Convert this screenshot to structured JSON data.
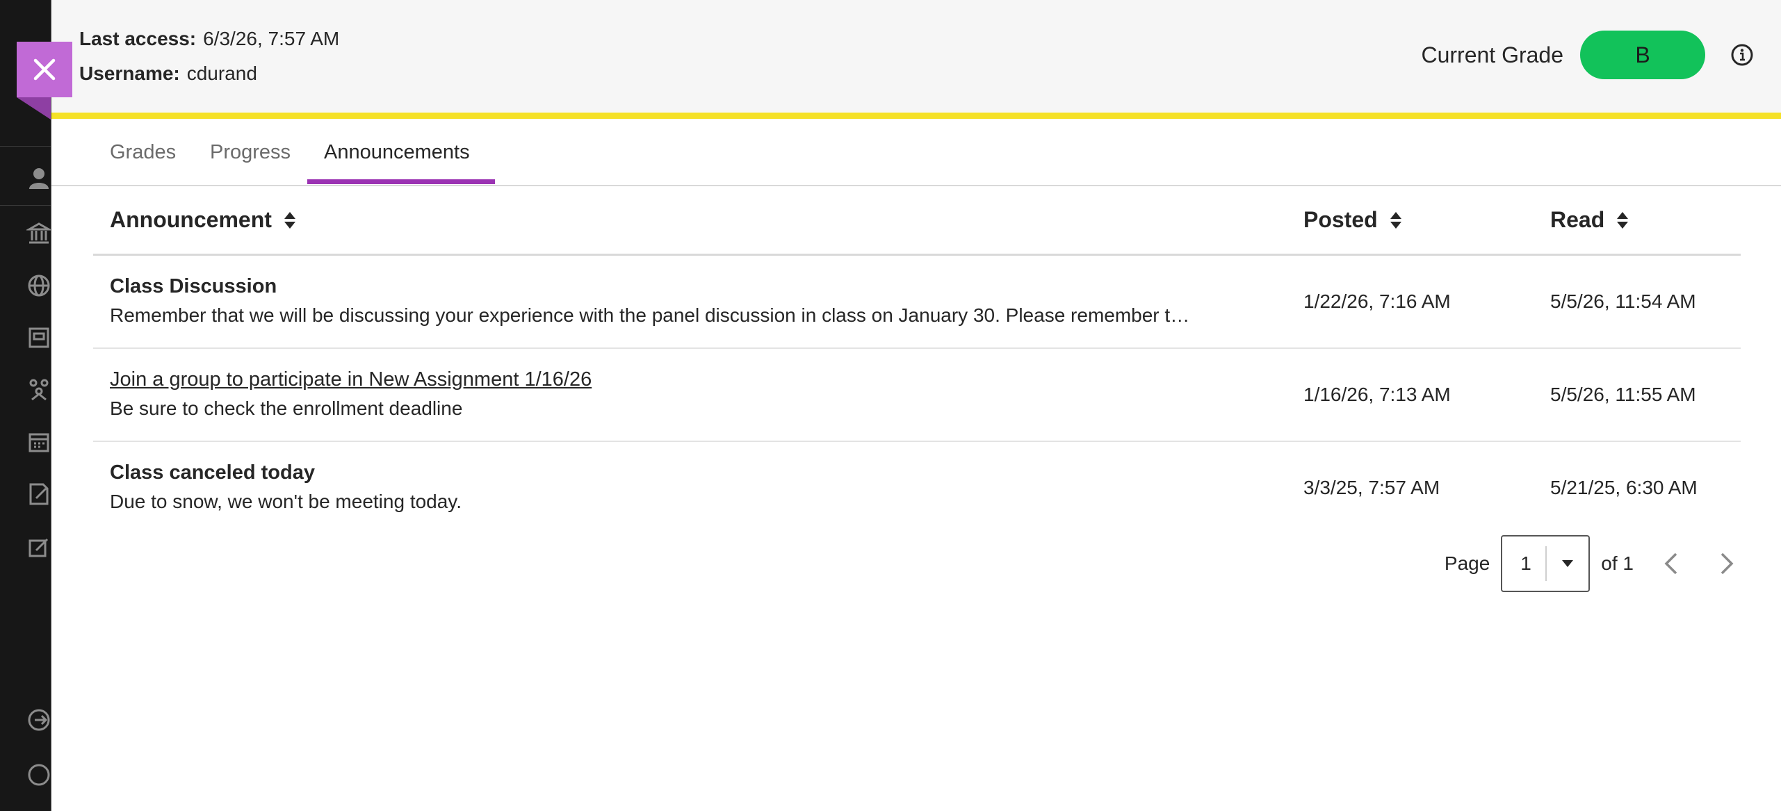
{
  "header": {
    "last_access_label": "Last access:",
    "last_access_value": "6/3/26, 7:57 AM",
    "username_label": "Username:",
    "username_value": "cdurand",
    "current_grade_label": "Current Grade",
    "current_grade_value": "B"
  },
  "tabs": [
    {
      "label": "Grades"
    },
    {
      "label": "Progress"
    },
    {
      "label": "Announcements",
      "active": true
    }
  ],
  "table": {
    "columns": [
      "Announcement",
      "Posted",
      "Read"
    ],
    "rows": [
      {
        "title": "Class Discussion",
        "body": "Remember that we will be discussing your experience with the panel discussion in class on January 30. Please remember t…",
        "posted": "1/22/26, 7:16 AM",
        "read": "5/5/26, 11:54 AM"
      },
      {
        "title": "Join a group to participate in New Assignment 1/16/26",
        "body": "Be sure to check the enrollment deadline",
        "posted": "1/16/26, 7:13 AM",
        "read": "5/5/26, 11:55 AM"
      },
      {
        "title": "Class canceled today",
        "body": "Due to snow, we won't be meeting today.",
        "posted": "3/3/25, 7:57 AM",
        "read": "5/21/25, 6:30 AM"
      }
    ]
  },
  "pagination": {
    "page_label": "Page",
    "page_value": "1",
    "of_label": "of 1"
  },
  "colors": {
    "grade_pill": "#12c25a",
    "accent_bar": "#f5e127",
    "tab_underline": "#9b33b3",
    "close_button": "#c16ad6"
  }
}
